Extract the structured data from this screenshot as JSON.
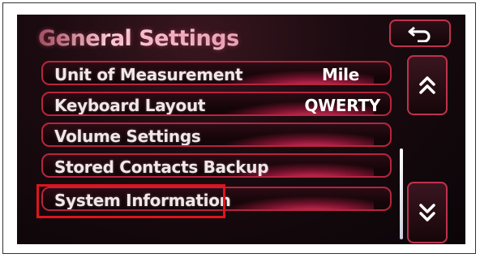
{
  "header": {
    "title": "General Settings"
  },
  "settings": {
    "items": [
      {
        "label": "Unit of Measurement",
        "value": "Mile"
      },
      {
        "label": "Keyboard Layout",
        "value": "QWERTY"
      },
      {
        "label": "Volume Settings",
        "value": ""
      },
      {
        "label": "Stored Contacts Backup",
        "value": ""
      },
      {
        "label": "System Information",
        "value": ""
      }
    ]
  },
  "colors": {
    "accent": "#c0324e",
    "highlight": "#e0141c",
    "background": "#1b0b10"
  },
  "icons": {
    "back": "back-arrow-icon",
    "up": "double-chevron-up-icon",
    "down": "double-chevron-down-icon"
  }
}
